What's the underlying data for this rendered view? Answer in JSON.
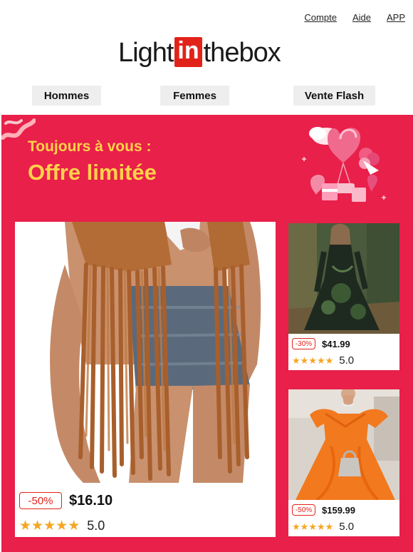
{
  "header": {
    "links": [
      "Compte",
      "Aide",
      "APP"
    ],
    "logo": {
      "left": "Light",
      "boxed": "in",
      "right": "thebox"
    }
  },
  "nav": {
    "items": [
      "Hommes",
      "Femmes",
      "Vente Flash"
    ]
  },
  "promo": {
    "subtitle": "Toujours à vous :",
    "headline": "Offre limitée",
    "colors": {
      "background": "#e8204a",
      "headline": "#ffd24a",
      "discount": "#e2231a",
      "star": "#f5a623"
    },
    "products": [
      {
        "discount": "-50%",
        "price": "$16.10",
        "stars": 5,
        "rating": "5.0"
      },
      {
        "discount": "-30%",
        "price": "$41.99",
        "stars": 5,
        "rating": "5.0"
      },
      {
        "discount": "-50%",
        "price": "$159.99",
        "stars": 5,
        "rating": "5.0"
      }
    ]
  }
}
